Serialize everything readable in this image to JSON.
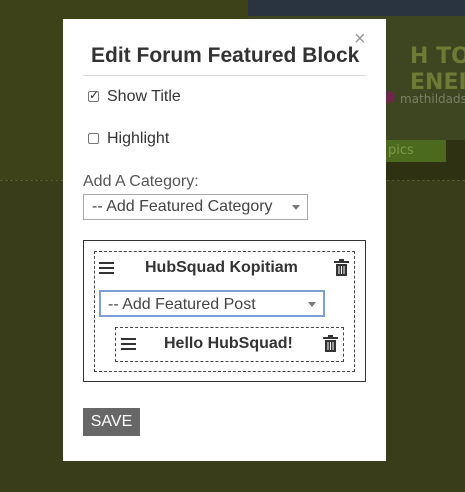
{
  "background": {
    "banner_text": "H TO\nENEI",
    "banner_user": "mathildads",
    "pics_button": "pics"
  },
  "modal": {
    "close_glyph": "×",
    "title": "Edit Forum Featured Block",
    "show_title": {
      "label": "Show Title",
      "checked": true
    },
    "highlight": {
      "label": "Highlight",
      "checked": false
    },
    "category_label": "Add A Category:",
    "category_select": "-- Add Featured Category",
    "category_block": {
      "title": "HubSquad Kopitiam",
      "post_select": "-- Add Featured Post",
      "post": {
        "title": "Hello HubSquad!"
      }
    },
    "save_label": "SAVE"
  },
  "colors": {
    "overlay": "#3a3d1a",
    "save_button": "#676767",
    "focus_border": "#7f9ed6"
  },
  "icons": [
    "close-icon",
    "checkbox-checked",
    "checkbox-unchecked",
    "chevron-down-icon",
    "drag-handle-icon",
    "trash-icon"
  ]
}
